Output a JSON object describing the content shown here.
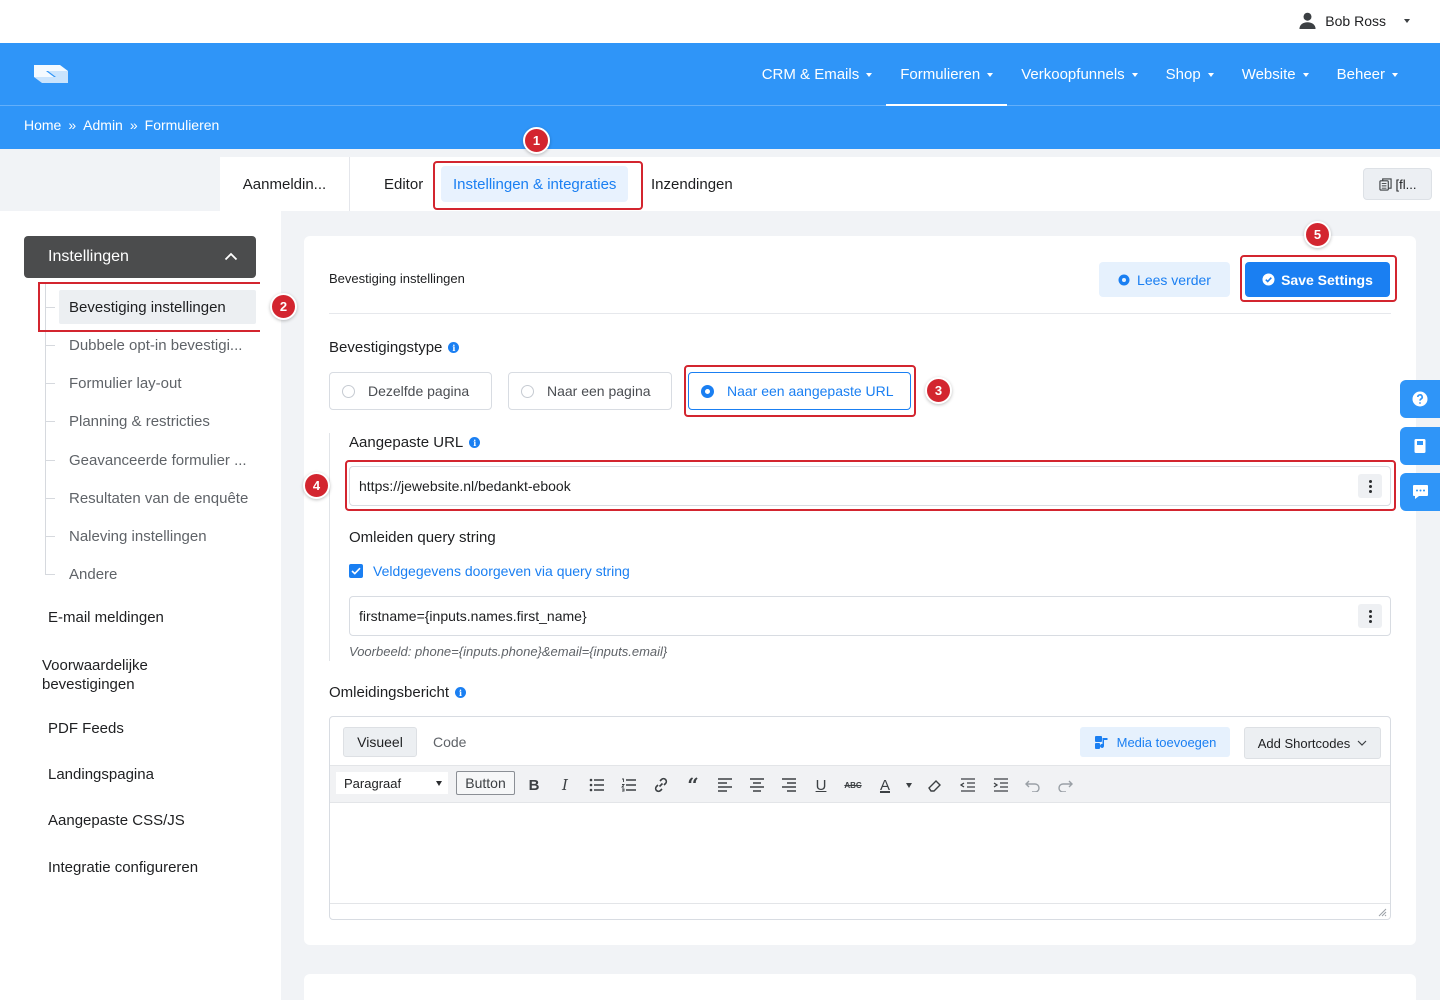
{
  "user": {
    "name": "Bob Ross"
  },
  "nav": {
    "items": [
      {
        "label": "CRM & Emails"
      },
      {
        "label": "Formulieren"
      },
      {
        "label": "Verkoopfunnels"
      },
      {
        "label": "Shop"
      },
      {
        "label": "Website"
      },
      {
        "label": "Beheer"
      }
    ],
    "active": "Formulieren"
  },
  "breadcrumb": {
    "items": [
      "Home",
      "Admin",
      "Formulieren"
    ],
    "separator": "»"
  },
  "tabs": {
    "form_name": "Aanmeldin...",
    "editor": "Editor",
    "settings": "Instellingen & integraties",
    "submissions": "Inzendingen",
    "shortcode": "[fl..."
  },
  "sidebar": {
    "header": "Instellingen",
    "subitems": [
      "Bevestiging instellingen",
      "Dubbele opt-in bevestigi...",
      "Formulier lay-out",
      "Planning & restricties",
      "Geavanceerde formulier ...",
      "Resultaten van de enquête",
      "Naleving instellingen",
      "Andere"
    ],
    "items": [
      "E-mail meldingen",
      "Voorwaardelijke bevestigingen",
      "PDF Feeds",
      "Landingspagina",
      "Aangepaste CSS/JS",
      "Integratie configureren"
    ]
  },
  "main": {
    "title": "Bevestiging instellingen",
    "read_more": "Lees verder",
    "save": "Save Settings",
    "confirmation_type": {
      "label": "Bevestigingstype",
      "options": [
        "Dezelfde pagina",
        "Naar een pagina",
        "Naar een aangepaste URL"
      ],
      "selected": "Naar een aangepaste URL"
    },
    "custom_url": {
      "label": "Aangepaste URL",
      "value": "https://jewebsite.nl/bedankt-ebook"
    },
    "query_string": {
      "label": "Omleiden query string",
      "checkbox_label": "Veldgegevens doorgeven via query string",
      "checked": true,
      "value": "firstname={inputs.names.first_name}",
      "hint": "Voorbeeld: phone={inputs.phone}&email={inputs.email}"
    },
    "redirect_message": {
      "label": "Omleidingsbericht",
      "tab_visual": "Visueel",
      "tab_code": "Code",
      "media_button": "Media toevoegen",
      "shortcodes_button": "Add Shortcodes",
      "paragraph_select": "Paragraaf",
      "button_tool": "Button"
    }
  },
  "annotations": [
    "1",
    "2",
    "3",
    "4",
    "5"
  ],
  "colors": {
    "primary": "#2f95f8",
    "accent": "#1a7ff2",
    "annotation": "#d3252f",
    "sidebar_header": "#4b4c4d"
  },
  "icons": [
    "user-icon",
    "caret-down-icon",
    "logo-icon",
    "chevron-up-icon",
    "info-icon",
    "play-circle-icon",
    "check-circle-icon",
    "kebab-icon",
    "checkbox-icon",
    "media-icon",
    "chevron-down-icon",
    "help-icon",
    "book-icon",
    "chat-icon",
    "copy-icon"
  ]
}
